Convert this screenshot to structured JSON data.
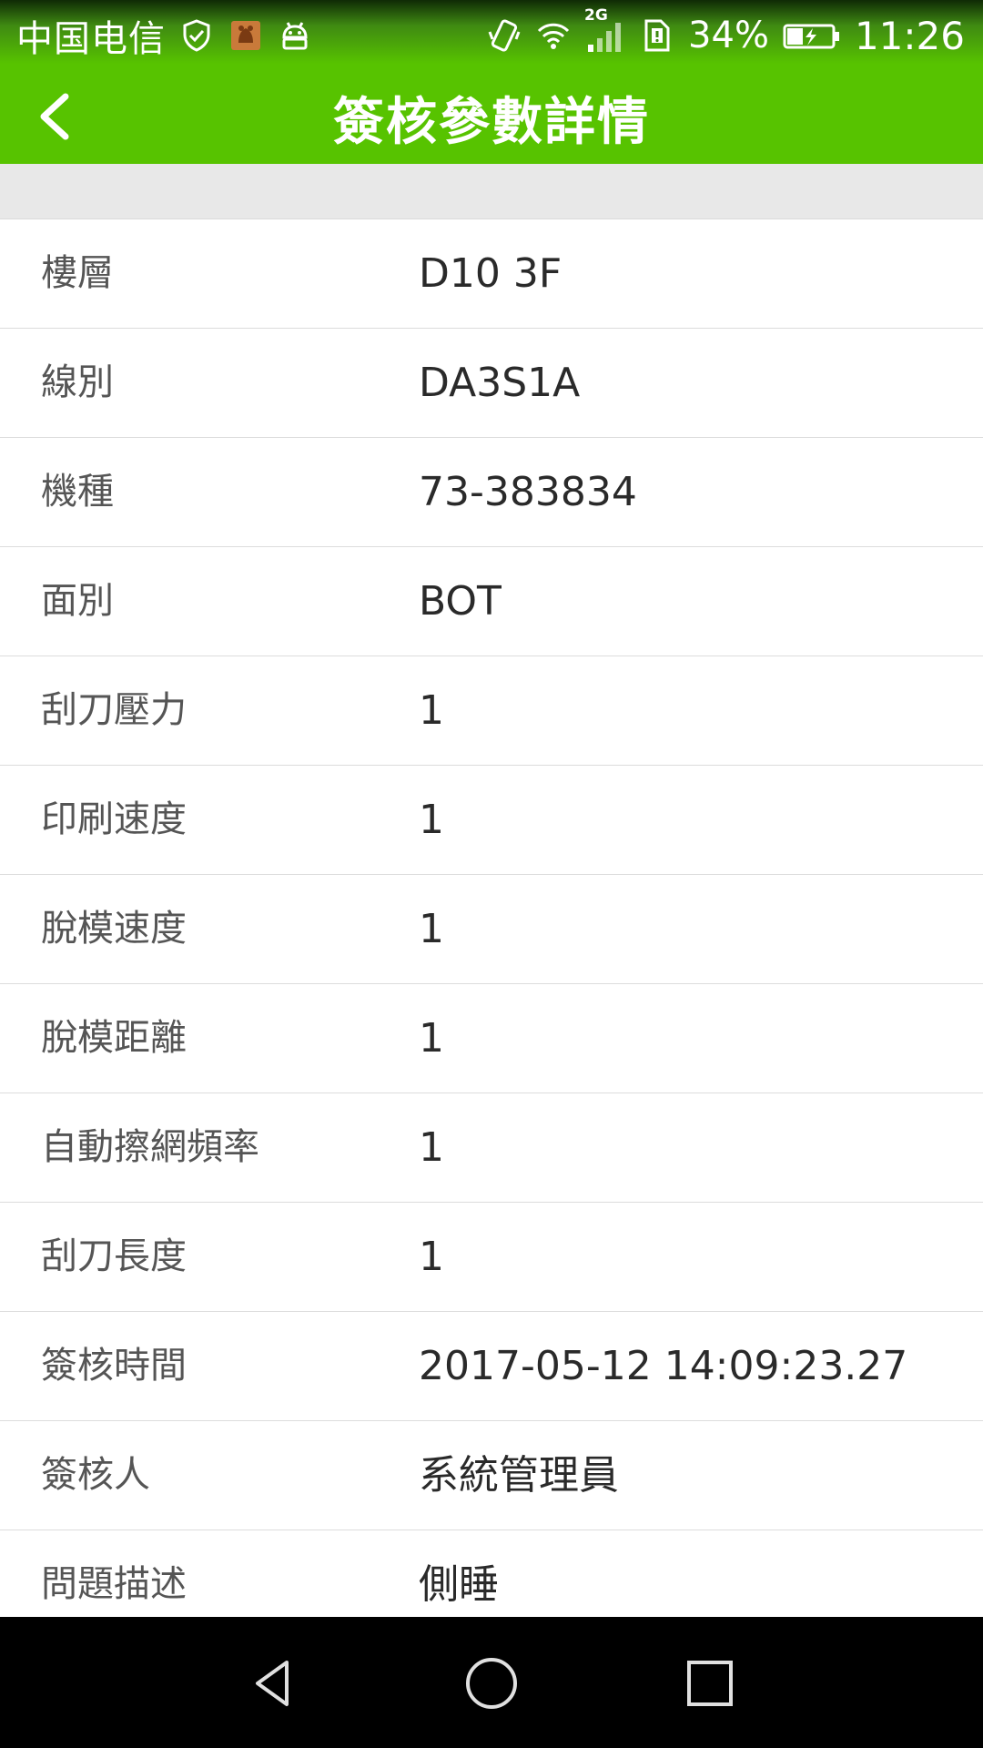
{
  "status_bar": {
    "carrier": "中国电信",
    "network": "2G",
    "battery": "34%",
    "time": "11:26"
  },
  "header": {
    "title": "簽核參數詳情"
  },
  "details": [
    {
      "label": "樓層",
      "value": "D10 3F"
    },
    {
      "label": "線別",
      "value": "DA3S1A"
    },
    {
      "label": "機種",
      "value": "73-383834"
    },
    {
      "label": "面別",
      "value": "BOT"
    },
    {
      "label": "刮刀壓力",
      "value": "1"
    },
    {
      "label": "印刷速度",
      "value": "1"
    },
    {
      "label": "脫模速度",
      "value": "1"
    },
    {
      "label": "脫模距離",
      "value": "1"
    },
    {
      "label": "自動擦網頻率",
      "value": "1"
    },
    {
      "label": "刮刀長度",
      "value": "1"
    },
    {
      "label": "簽核時間",
      "value": "2017-05-12 14:09:23.27"
    },
    {
      "label": "簽核人",
      "value": "系統管理員"
    },
    {
      "label": "問題描述",
      "value": "側睡"
    }
  ],
  "colors": {
    "header_green": "#57c300",
    "divider": "#dcdcdc",
    "spacer_gray": "#e8e8e8"
  },
  "icons": {
    "status_left": [
      "shield-check-icon",
      "app-notification-icon",
      "android-icon"
    ],
    "status_right": [
      "vibrate-icon",
      "wifi-icon",
      "signal-icon",
      "sim-alert-icon",
      "battery-charging-icon"
    ],
    "header": "chevron-left-icon",
    "nav": [
      "nav-back-icon",
      "nav-home-icon",
      "nav-recents-icon"
    ]
  }
}
